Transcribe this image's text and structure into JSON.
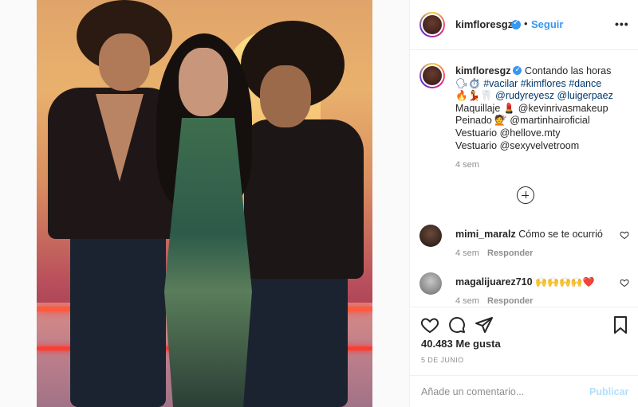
{
  "header": {
    "username": "kimfloresgz",
    "follow_label": "Seguir",
    "more_label": "•••"
  },
  "caption": {
    "username": "kimfloresgz",
    "lines": [
      "Contando las horas",
      "🗣⏱ #vacilar #kimflores #dance",
      "🔥💃🦷 @rudyreyesz @luigerpaez",
      "Maquillaje 💄 @kevinrivasmakeup",
      "Peinado 💇 @martinhairoficial",
      "Vestuario @hellove.mty",
      "Vestuario @sexyvelvetroom"
    ],
    "time": "4 sem"
  },
  "comments": [
    {
      "username": "mimi_maralz",
      "text": "Cómo se te ocurrió",
      "time": "4 sem",
      "reply_label": "Responder",
      "avatar_color": "#3a2a24"
    },
    {
      "username": "magalijuarez710",
      "text": "🙌🙌🙌🙌❤️",
      "time": "4 sem",
      "reply_label": "Responder",
      "avatar_color": "#8c8c8c"
    }
  ],
  "actions": {
    "likes": "40.483 Me gusta",
    "date": "5 DE JUNIO"
  },
  "add_comment": {
    "placeholder": "Añade un comentario...",
    "publish_label": "Publicar"
  },
  "colors": {
    "accent": "#3897f0",
    "publish_disabled": "#b2dffc",
    "hashtag": "#00376b"
  }
}
